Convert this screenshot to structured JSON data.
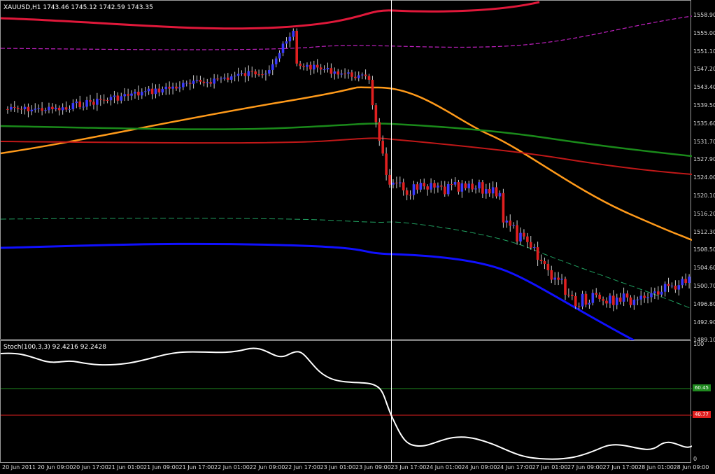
{
  "main": {
    "title": "XAUUSD,H1  1743.46 1745.12 1742.59 1743.35",
    "price_ticks": [
      "1558.90",
      "1555.00",
      "1551.10",
      "1547.20",
      "1543.40",
      "1539.50",
      "1535.60",
      "1531.70",
      "1527.90",
      "1524.00",
      "1520.10",
      "1516.20",
      "1512.30",
      "1508.50",
      "1504.60",
      "1500.70",
      "1496.80",
      "1492.90",
      "1489.10"
    ]
  },
  "stoch": {
    "title": "Stoch(100,3,3) 92.4216 92.2428",
    "ticks": [
      "100",
      "0"
    ],
    "level_high": "60.45",
    "level_low": "40.77",
    "level_high_color": "#1f8a1f",
    "level_low_color": "#e02020"
  },
  "time_labels": [
    "20 Jun 2011",
    "20 Jun 09:00",
    "20 Jun 17:00",
    "21 Jun 01:00",
    "21 Jun 09:00",
    "21 Jun 17:00",
    "22 Jun 01:00",
    "22 Jun 09:00",
    "22 Jun 17:00",
    "23 Jun 01:00",
    "23 Jun 09:00",
    "23 Jun 17:00",
    "24 Jun 01:00",
    "24 Jun 09:00",
    "24 Jun 17:00",
    "27 Jun 01:00",
    "27 Jun 09:00",
    "27 Jun 17:00",
    "28 Jun 01:00",
    "28 Jun 09:00"
  ],
  "colors": {
    "bull_candle": "#3a3aff",
    "bear_candle": "#e02020",
    "band_outer": "#e0183a",
    "band_outer_dash": "#c020c0",
    "ma_fast": "#ff9a1a",
    "ma_green": "#1a8a1a",
    "ma_red": "#c01818",
    "env_dash": "#20a060",
    "ma_blue": "#1010ff",
    "stoch_line": "#ffffff"
  }
}
